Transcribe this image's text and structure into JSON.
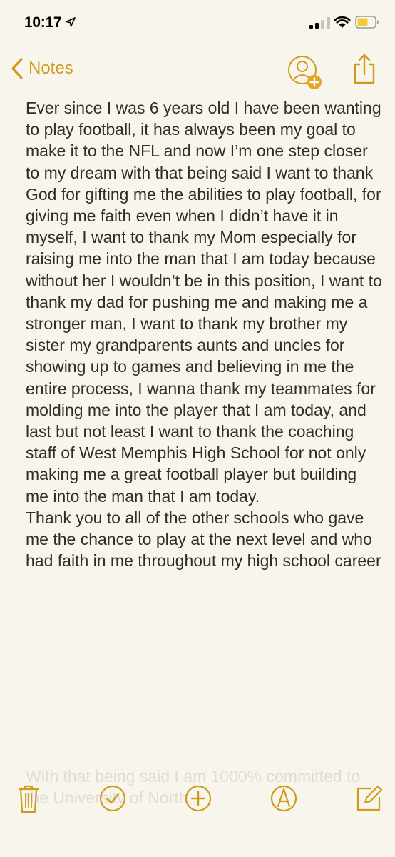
{
  "status_bar": {
    "time": "10:17",
    "icons": [
      "location-arrow-icon",
      "cellular-signal-icon",
      "wifi-icon",
      "battery-icon"
    ]
  },
  "nav": {
    "back_label": "Notes",
    "accent_color": "#cf9b1f",
    "icons": [
      "chevron-left-icon",
      "add-people-icon",
      "share-icon"
    ]
  },
  "note": {
    "body": "Ever since I was 6 years old I have been wanting to play football, it has always been my goal to make it to the NFL and now I’m one step closer to my dream with that being said I want to thank God for gifting me the abilities to play football, for giving me faith even when I didn’t have it in myself, I want to thank my Mom especially for raising me into the man that I am today because without her I wouldn’t be in this position, I want to thank my dad for pushing me and making me a stronger man, I want to thank my brother my sister my grandparents aunts and uncles for showing up to games and believing in me the entire process, I wanna thank my teammates for molding me into the player that I am today, and last but not least I want to thank the coaching staff of West Memphis High School for not only making me a great football player but building me into the man that I am today.",
    "body2": "Thank you to all of the other schools who gave me the chance to play at the next level and who had faith in me throughout my high school career",
    "faded": "With that being said I am 1000% committed to the University of North"
  },
  "toolbar": {
    "icons": [
      "trash-icon",
      "checklist-icon",
      "add-icon",
      "sketch-icon",
      "compose-icon"
    ]
  }
}
